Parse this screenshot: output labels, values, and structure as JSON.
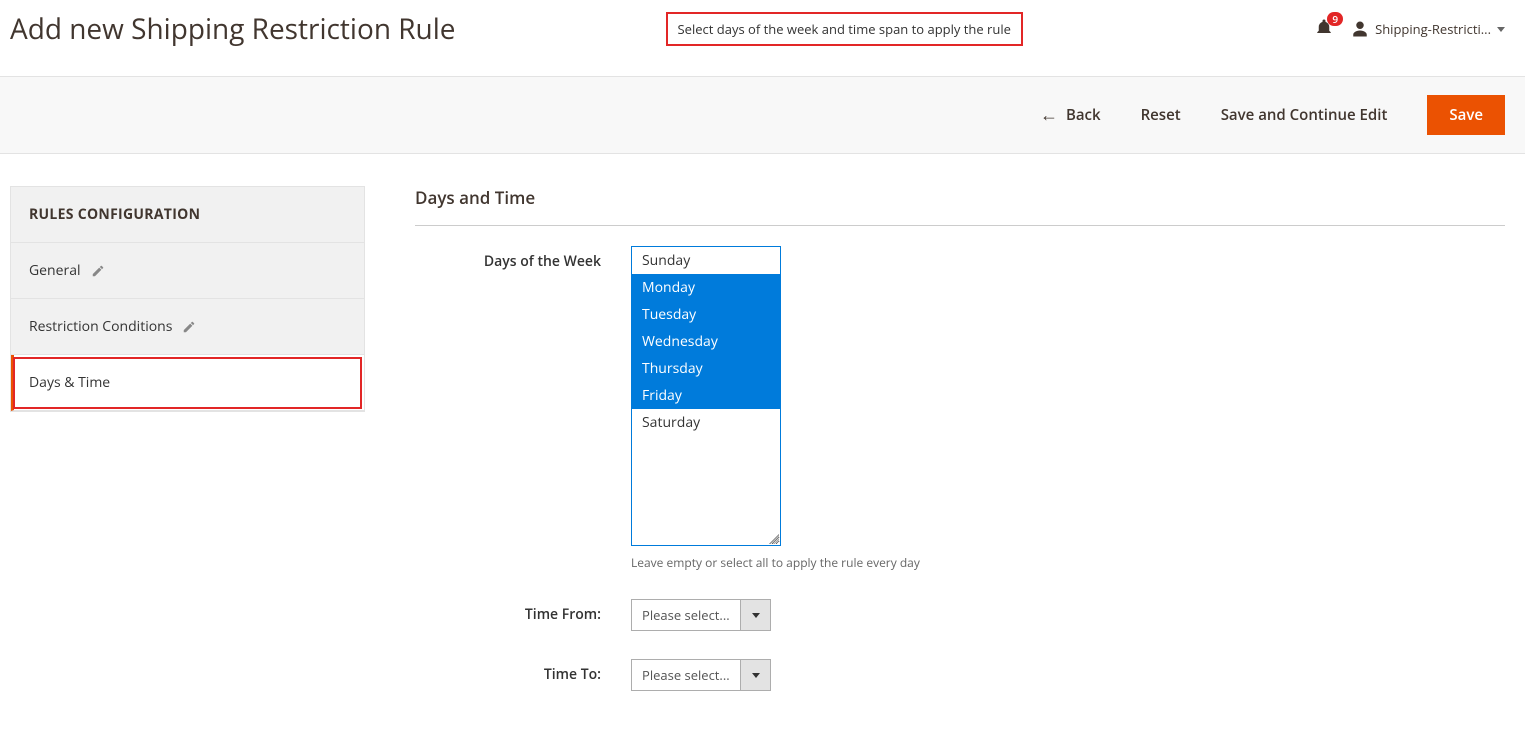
{
  "header": {
    "title": "Add new Shipping Restriction Rule",
    "callout": "Select days of the week and time span to apply the rule",
    "notification_count": "9",
    "username": "Shipping-Restricti..."
  },
  "actions": {
    "back": "Back",
    "reset": "Reset",
    "save_continue": "Save and Continue Edit",
    "save": "Save"
  },
  "sidebar": {
    "title": "RULES CONFIGURATION",
    "items": [
      {
        "label": "General",
        "has_icon": true,
        "active": false
      },
      {
        "label": "Restriction Conditions",
        "has_icon": true,
        "active": false
      },
      {
        "label": "Days & Time",
        "has_icon": false,
        "active": true
      }
    ]
  },
  "section": {
    "heading": "Days and Time",
    "days_label": "Days of the Week",
    "days_options": [
      {
        "label": "Sunday",
        "selected": false
      },
      {
        "label": "Monday",
        "selected": true
      },
      {
        "label": "Tuesday",
        "selected": true
      },
      {
        "label": "Wednesday",
        "selected": true
      },
      {
        "label": "Thursday",
        "selected": true
      },
      {
        "label": "Friday",
        "selected": true
      },
      {
        "label": "Saturday",
        "selected": false
      }
    ],
    "days_hint": "Leave empty or select all to apply the rule every day",
    "time_from_label": "Time From:",
    "time_from_value": "Please select...",
    "time_to_label": "Time To:",
    "time_to_value": "Please select..."
  }
}
